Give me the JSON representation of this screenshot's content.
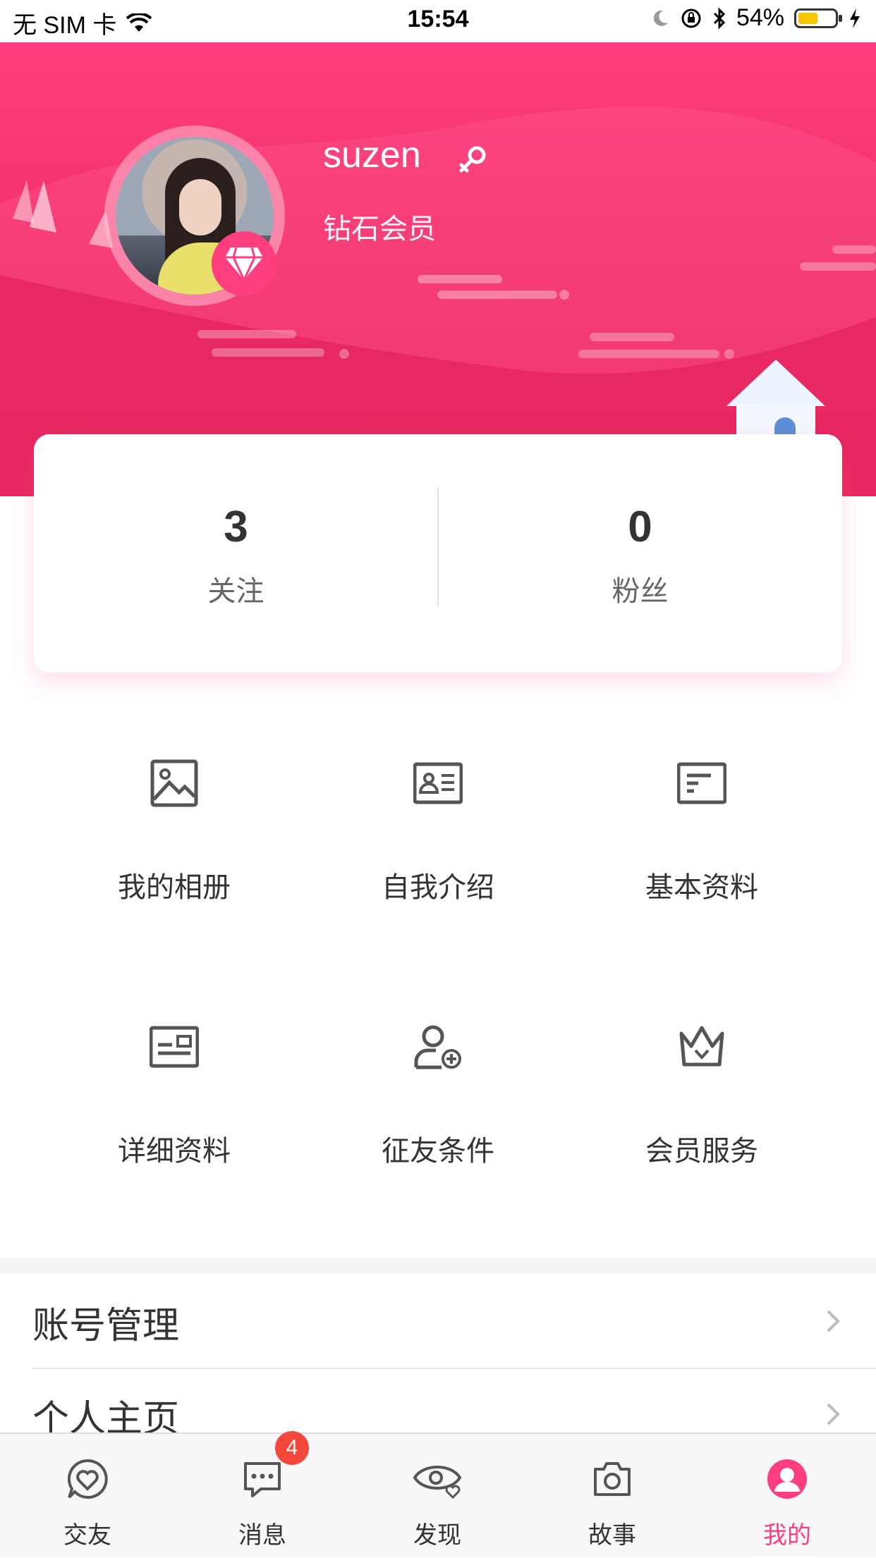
{
  "status_bar": {
    "carrier": "无 SIM 卡",
    "time": "15:54",
    "battery_percent": "54%",
    "battery_level": 0.54,
    "icons": [
      "wifi-icon",
      "moon-icon",
      "rotation-lock-icon",
      "bluetooth-icon",
      "battery-icon",
      "charging-icon"
    ]
  },
  "profile": {
    "username": "suzen",
    "gender_icon": "female-icon",
    "member_level": "钻石会员",
    "badge_icon": "diamond-icon",
    "accent_color": "#ff3f7d"
  },
  "stats": [
    {
      "value": "3",
      "label": "关注"
    },
    {
      "value": "0",
      "label": "粉丝"
    }
  ],
  "grid": [
    {
      "label": "我的相册",
      "icon": "image-icon"
    },
    {
      "label": "自我介绍",
      "icon": "id-card-icon"
    },
    {
      "label": "基本资料",
      "icon": "document-icon"
    },
    {
      "label": "详细资料",
      "icon": "profile-card-icon"
    },
    {
      "label": "征友条件",
      "icon": "add-person-icon"
    },
    {
      "label": "会员服务",
      "icon": "crown-icon"
    }
  ],
  "list": [
    {
      "label": "账号管理",
      "icon": "chevron-right-icon"
    },
    {
      "label": "个人主页",
      "icon": "chevron-right-icon"
    }
  ],
  "tab_bar": {
    "tabs": [
      {
        "label": "交友",
        "icon": "heart-chat-icon",
        "active": false
      },
      {
        "label": "消息",
        "icon": "message-icon",
        "active": false,
        "badge": "4"
      },
      {
        "label": "发现",
        "icon": "eye-heart-icon",
        "active": false
      },
      {
        "label": "故事",
        "icon": "camera-icon",
        "active": false
      },
      {
        "label": "我的",
        "icon": "user-icon",
        "active": true
      }
    ],
    "active_color": "#ff3f7d"
  }
}
